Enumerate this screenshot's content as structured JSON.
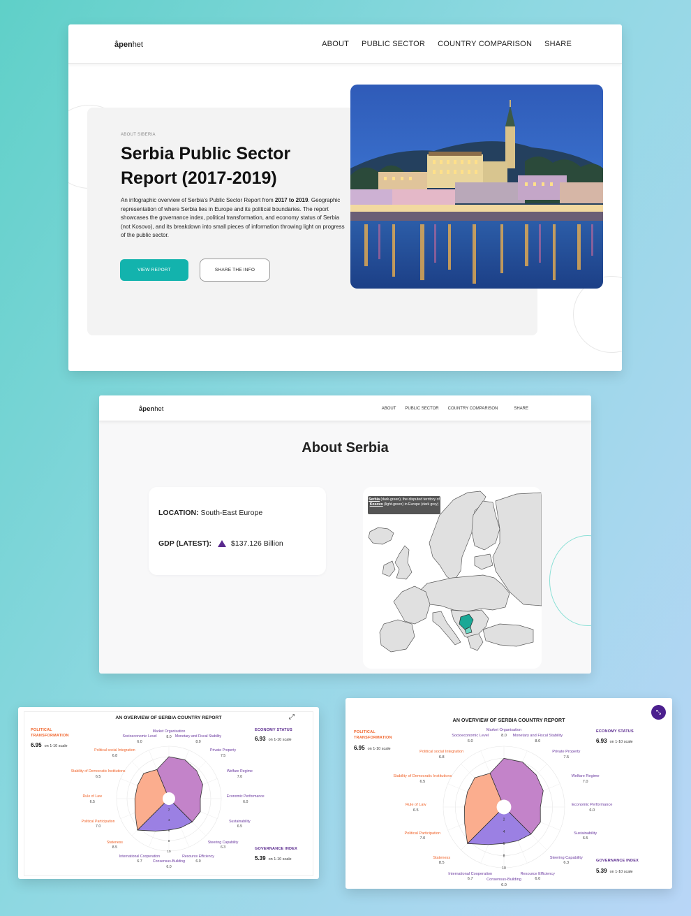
{
  "brand": {
    "prefix": "åpen",
    "suffix": "het"
  },
  "nav": {
    "items": [
      "ABOUT",
      "PUBLIC SECTOR",
      "COUNTRY COMPARISON",
      "SHARE"
    ]
  },
  "hero": {
    "eyebrow": "ABOUT SIBERIA",
    "title": "Serbia Public Sector Report (2017-2019)",
    "desc_pre": "An infographic overview of Serbia’s Public Sector Report from ",
    "desc_years": "2017 to 2019",
    "desc_post": ". Geographic representation of where Serbia lies in Europe and its political boundaries. The report showcases the governance index, political transformation, and economy status of Serbia (not Kosovo), and its breakdown into small pieces of information throwing light on progress of the public sector.",
    "btn_view": "VIEW REPORT",
    "btn_share": "SHARE THE INFO",
    "photo": "belgrade-riverfront-night-photo"
  },
  "about": {
    "title": "About Serbia",
    "location_label": "LOCATION:",
    "location_value": "South-East Europe",
    "gdp_label": "GDP (LATEST):",
    "gdp_value": "$137.126 Billion",
    "gdp_icon": "trend-up-triangle-icon",
    "map_tip_a": "Serbia",
    "map_tip_b": " (dark-green), the disputed territory of ",
    "map_tip_c": "Kosovo",
    "map_tip_d": " (light-green) in Europe (dark grey)",
    "map_colors": {
      "serbia": "#1aa896",
      "kosovo": "#6dd6c4",
      "europe": "#e0e0e0"
    }
  },
  "report": {
    "title": "AN OVERVIEW OF SERBIA COUNTRY REPORT",
    "political": {
      "label": "POLITICAL TRANSFORMATION",
      "score": "6.95",
      "scale": "on 1-10 scale"
    },
    "economy": {
      "label": "ECONOMY STATUS",
      "score": "6.93",
      "scale": "on 1-10 scale"
    },
    "governance": {
      "label": "GOVERNANCE INDEX",
      "score": "5.39",
      "scale": "on 1-10 scale"
    },
    "colors": {
      "economy": "#c383c9",
      "governance": "#9b80e3",
      "political": "#fbad8e"
    },
    "axes": [
      {
        "name": "Market Organisation",
        "value": "8.0",
        "group": "economy"
      },
      {
        "name": "Monetary and Fiscal Stability",
        "value": "8.0",
        "group": "economy"
      },
      {
        "name": "Private Property",
        "value": "7.5",
        "group": "economy"
      },
      {
        "name": "Welfare Regime",
        "value": "7.0",
        "group": "economy"
      },
      {
        "name": "Economic Performance",
        "value": "6.0",
        "group": "economy"
      },
      {
        "name": "Sustainability",
        "value": "6.5",
        "group": "economy"
      },
      {
        "name": "Steering Capability",
        "value": "6.3",
        "group": "governance"
      },
      {
        "name": "Resource Efficiency",
        "value": "6.0",
        "group": "governance"
      },
      {
        "name": "Consensus-Building",
        "value": "6.0",
        "group": "governance"
      },
      {
        "name": "International Cooperation",
        "value": "6.7",
        "group": "governance"
      },
      {
        "name": "Stateness",
        "value": "8.5",
        "group": "political"
      },
      {
        "name": "Political Participation",
        "value": "7.0",
        "group": "political"
      },
      {
        "name": "Rule of Law",
        "value": "6.5",
        "group": "political"
      },
      {
        "name": "Stability of Democratic Institutions",
        "value": "6.5",
        "group": "political"
      },
      {
        "name": "Political social Integration",
        "value": "6.8",
        "group": "political"
      },
      {
        "name": "Socioeconomic Level",
        "value": "6.0",
        "group": "economy"
      }
    ],
    "ticks": [
      "2",
      "4",
      "6",
      "8",
      "10"
    ]
  }
}
